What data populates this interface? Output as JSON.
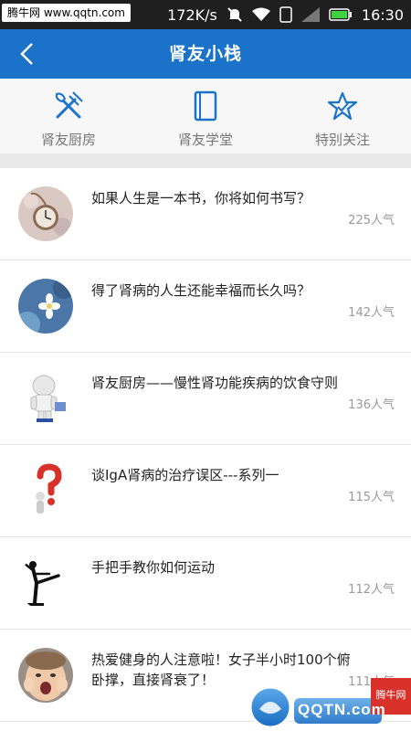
{
  "status": {
    "watermark": "腾牛网 www.qqtn.com",
    "speed": "172K/s",
    "time": "16:30"
  },
  "header": {
    "title": "肾友小栈"
  },
  "categories": [
    {
      "label": "肾友厨房",
      "icon": "fork-knife-icon"
    },
    {
      "label": "肾友学堂",
      "icon": "book-icon"
    },
    {
      "label": "特别关注",
      "icon": "star-icon"
    }
  ],
  "articles": [
    {
      "title": "如果人生是一本书，你将如何书写？",
      "popularity": "225人气",
      "avatar": "pocket-watch"
    },
    {
      "title": "得了肾病的人生还能幸福而长久吗？",
      "popularity": "142人气",
      "avatar": "white-flower"
    },
    {
      "title": "肾友厨房——慢性肾功能疾病的饮食守则",
      "popularity": "136人气",
      "avatar": "3d-figure"
    },
    {
      "title": "谈IgA肾病的治疗误区---系列一",
      "popularity": "115人气",
      "avatar": "question-mark-figure"
    },
    {
      "title": "手把手教你如何运动",
      "popularity": "112人气",
      "avatar": "dancer-silhouette"
    },
    {
      "title": "热爱健身的人注意啦！女子半小时100个俯卧撑，直接肾衰了！",
      "popularity": "111人气",
      "avatar": "child-face"
    }
  ],
  "watermark_br": {
    "brand": "腾牛网",
    "text": "QQTN.com"
  },
  "colors": {
    "header": "#1a73c8",
    "accent": "#1a73c8"
  }
}
